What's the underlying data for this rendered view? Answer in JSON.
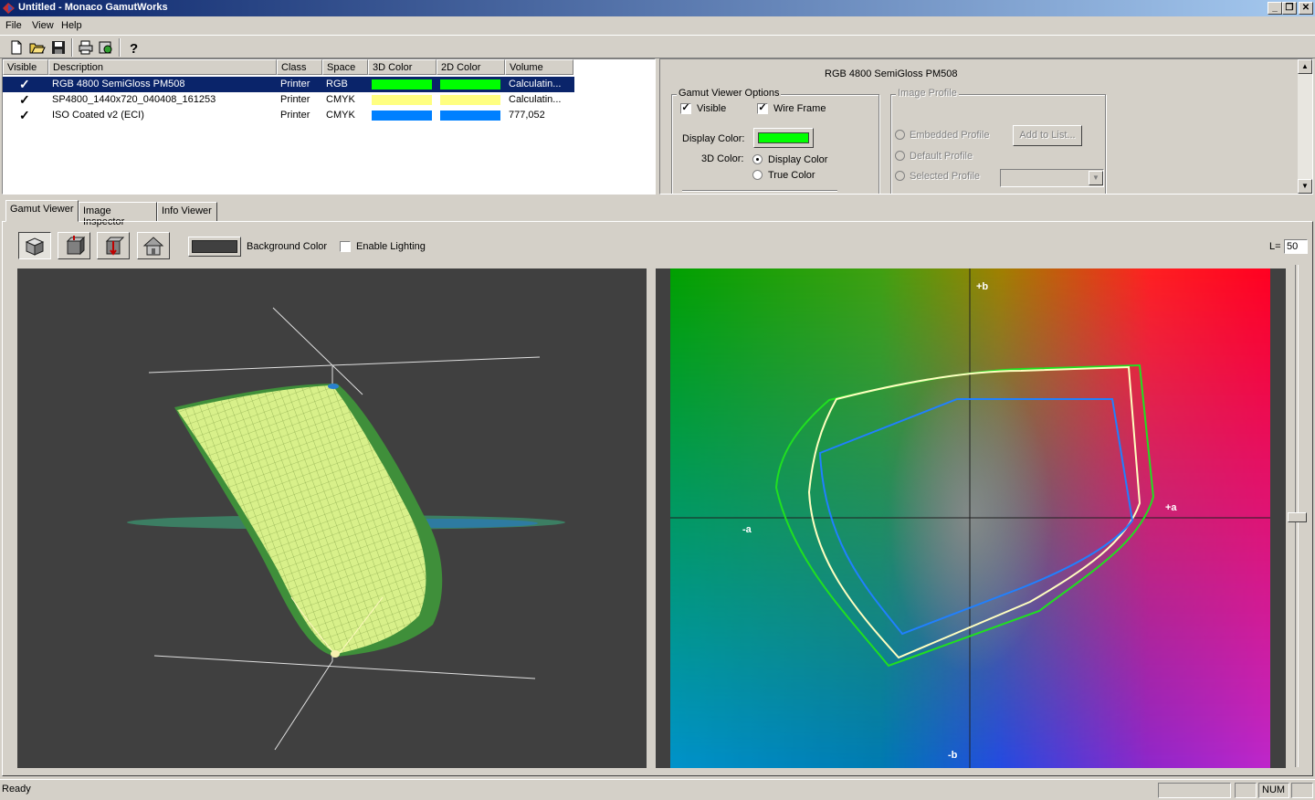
{
  "window": {
    "title": "Untitled - Monaco GamutWorks",
    "min": "_",
    "restore": "❐",
    "close": "✕"
  },
  "menu": [
    "File",
    "View",
    "Help"
  ],
  "toolbar_icons": [
    "new-file-icon",
    "open-folder-icon",
    "save-icon",
    "print-icon",
    "settings-icon",
    "help-icon"
  ],
  "profile_list": {
    "headers": [
      "Visible",
      "Description",
      "Class",
      "Space",
      "3D Color",
      "2D Color",
      "Volume"
    ],
    "rows": [
      {
        "visible": "✓",
        "description": "RGB 4800 SemiGloss PM508",
        "class": "Printer",
        "space": "RGB",
        "color3d": "#00ff00",
        "color2d": "#00ff00",
        "volume": "Calculatin...",
        "selected": true
      },
      {
        "visible": "✓",
        "description": "SP4800_1440x720_040408_161253",
        "class": "Printer",
        "space": "CMYK",
        "color3d": "#ffff80",
        "color2d": "#ffff80",
        "volume": "Calculatin...",
        "selected": false
      },
      {
        "visible": "✓",
        "description": "ISO Coated v2 (ECI)",
        "class": "Printer",
        "space": "CMYK",
        "color3d": "#0080ff",
        "color2d": "#0080ff",
        "volume": "777,052",
        "selected": false
      }
    ]
  },
  "options": {
    "profile_name": "RGB 4800 SemiGloss PM508",
    "gamut_group_title": "Gamut Viewer Options",
    "visible_label": "Visible",
    "wireframe_label": "Wire Frame",
    "display_color_label": "Display Color:",
    "display_color": "#00ff00",
    "color3d_label": "3D Color:",
    "radio_display_color": "Display Color",
    "radio_true_color": "True Color",
    "image_group_title": "Image Profile",
    "embedded_profile": "Embedded Profile",
    "default_profile": "Default Profile",
    "selected_profile": "Selected Profile",
    "add_to_list": "Add to List..."
  },
  "tabs": [
    "Gamut Viewer",
    "Image Inspector",
    "Info Viewer"
  ],
  "viewer": {
    "background_color_label": "Background Color",
    "background_color": "#404040",
    "enable_lighting_label": "Enable Lighting",
    "l_label": "L=",
    "l_value": "50",
    "axis_plus_b": "+b",
    "axis_minus_b": "-b",
    "axis_plus_a": "+a",
    "axis_minus_a": "-a"
  },
  "status": {
    "text": "Ready",
    "num": "NUM"
  }
}
